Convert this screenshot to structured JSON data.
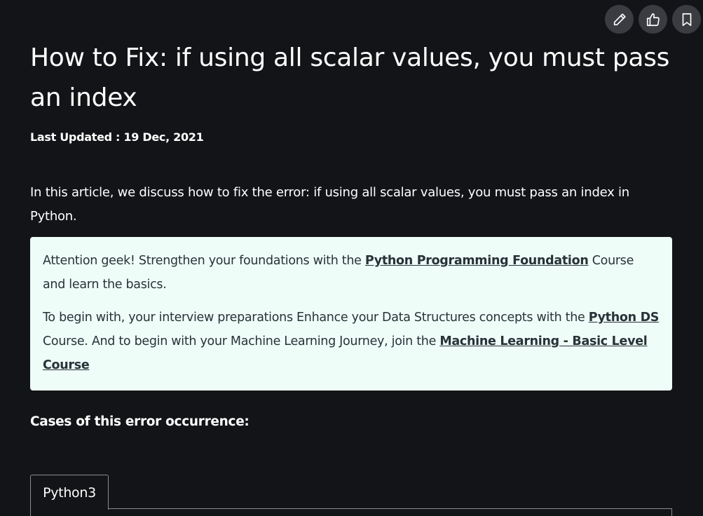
{
  "toolbar": {
    "edit_icon": "pencil-icon",
    "like_icon": "thumbs-up-icon",
    "bookmark_icon": "bookmark-icon"
  },
  "article": {
    "title": "How to Fix: if using all scalar values, you must pass an index",
    "last_updated": "Last Updated : 19 Dec, 2021",
    "intro": "In this article, we discuss how to fix the error: if using all scalar values, you must pass an index in Python."
  },
  "callout": {
    "p1_before": " Attention geek! Strengthen your foundations with the ",
    "p1_link": "Python Programming Foundation",
    "p1_after": " Course and learn the basics.",
    "p2_before": "To begin with, your interview preparations Enhance your Data Structures concepts with the ",
    "p2_link1": "Python DS",
    "p2_middle": " Course. And to begin with your Machine Learning Journey, join the ",
    "p2_link2": "Machine Learning - Basic Level Course",
    "background_color": "#effdf8"
  },
  "section": {
    "heading": "Cases of this error occurrence:"
  },
  "code_tabs": [
    {
      "label": "Python3"
    }
  ],
  "colors": {
    "page_background": "#131417",
    "text": "#ffffff",
    "toolbar_button": "#3a3c41"
  }
}
